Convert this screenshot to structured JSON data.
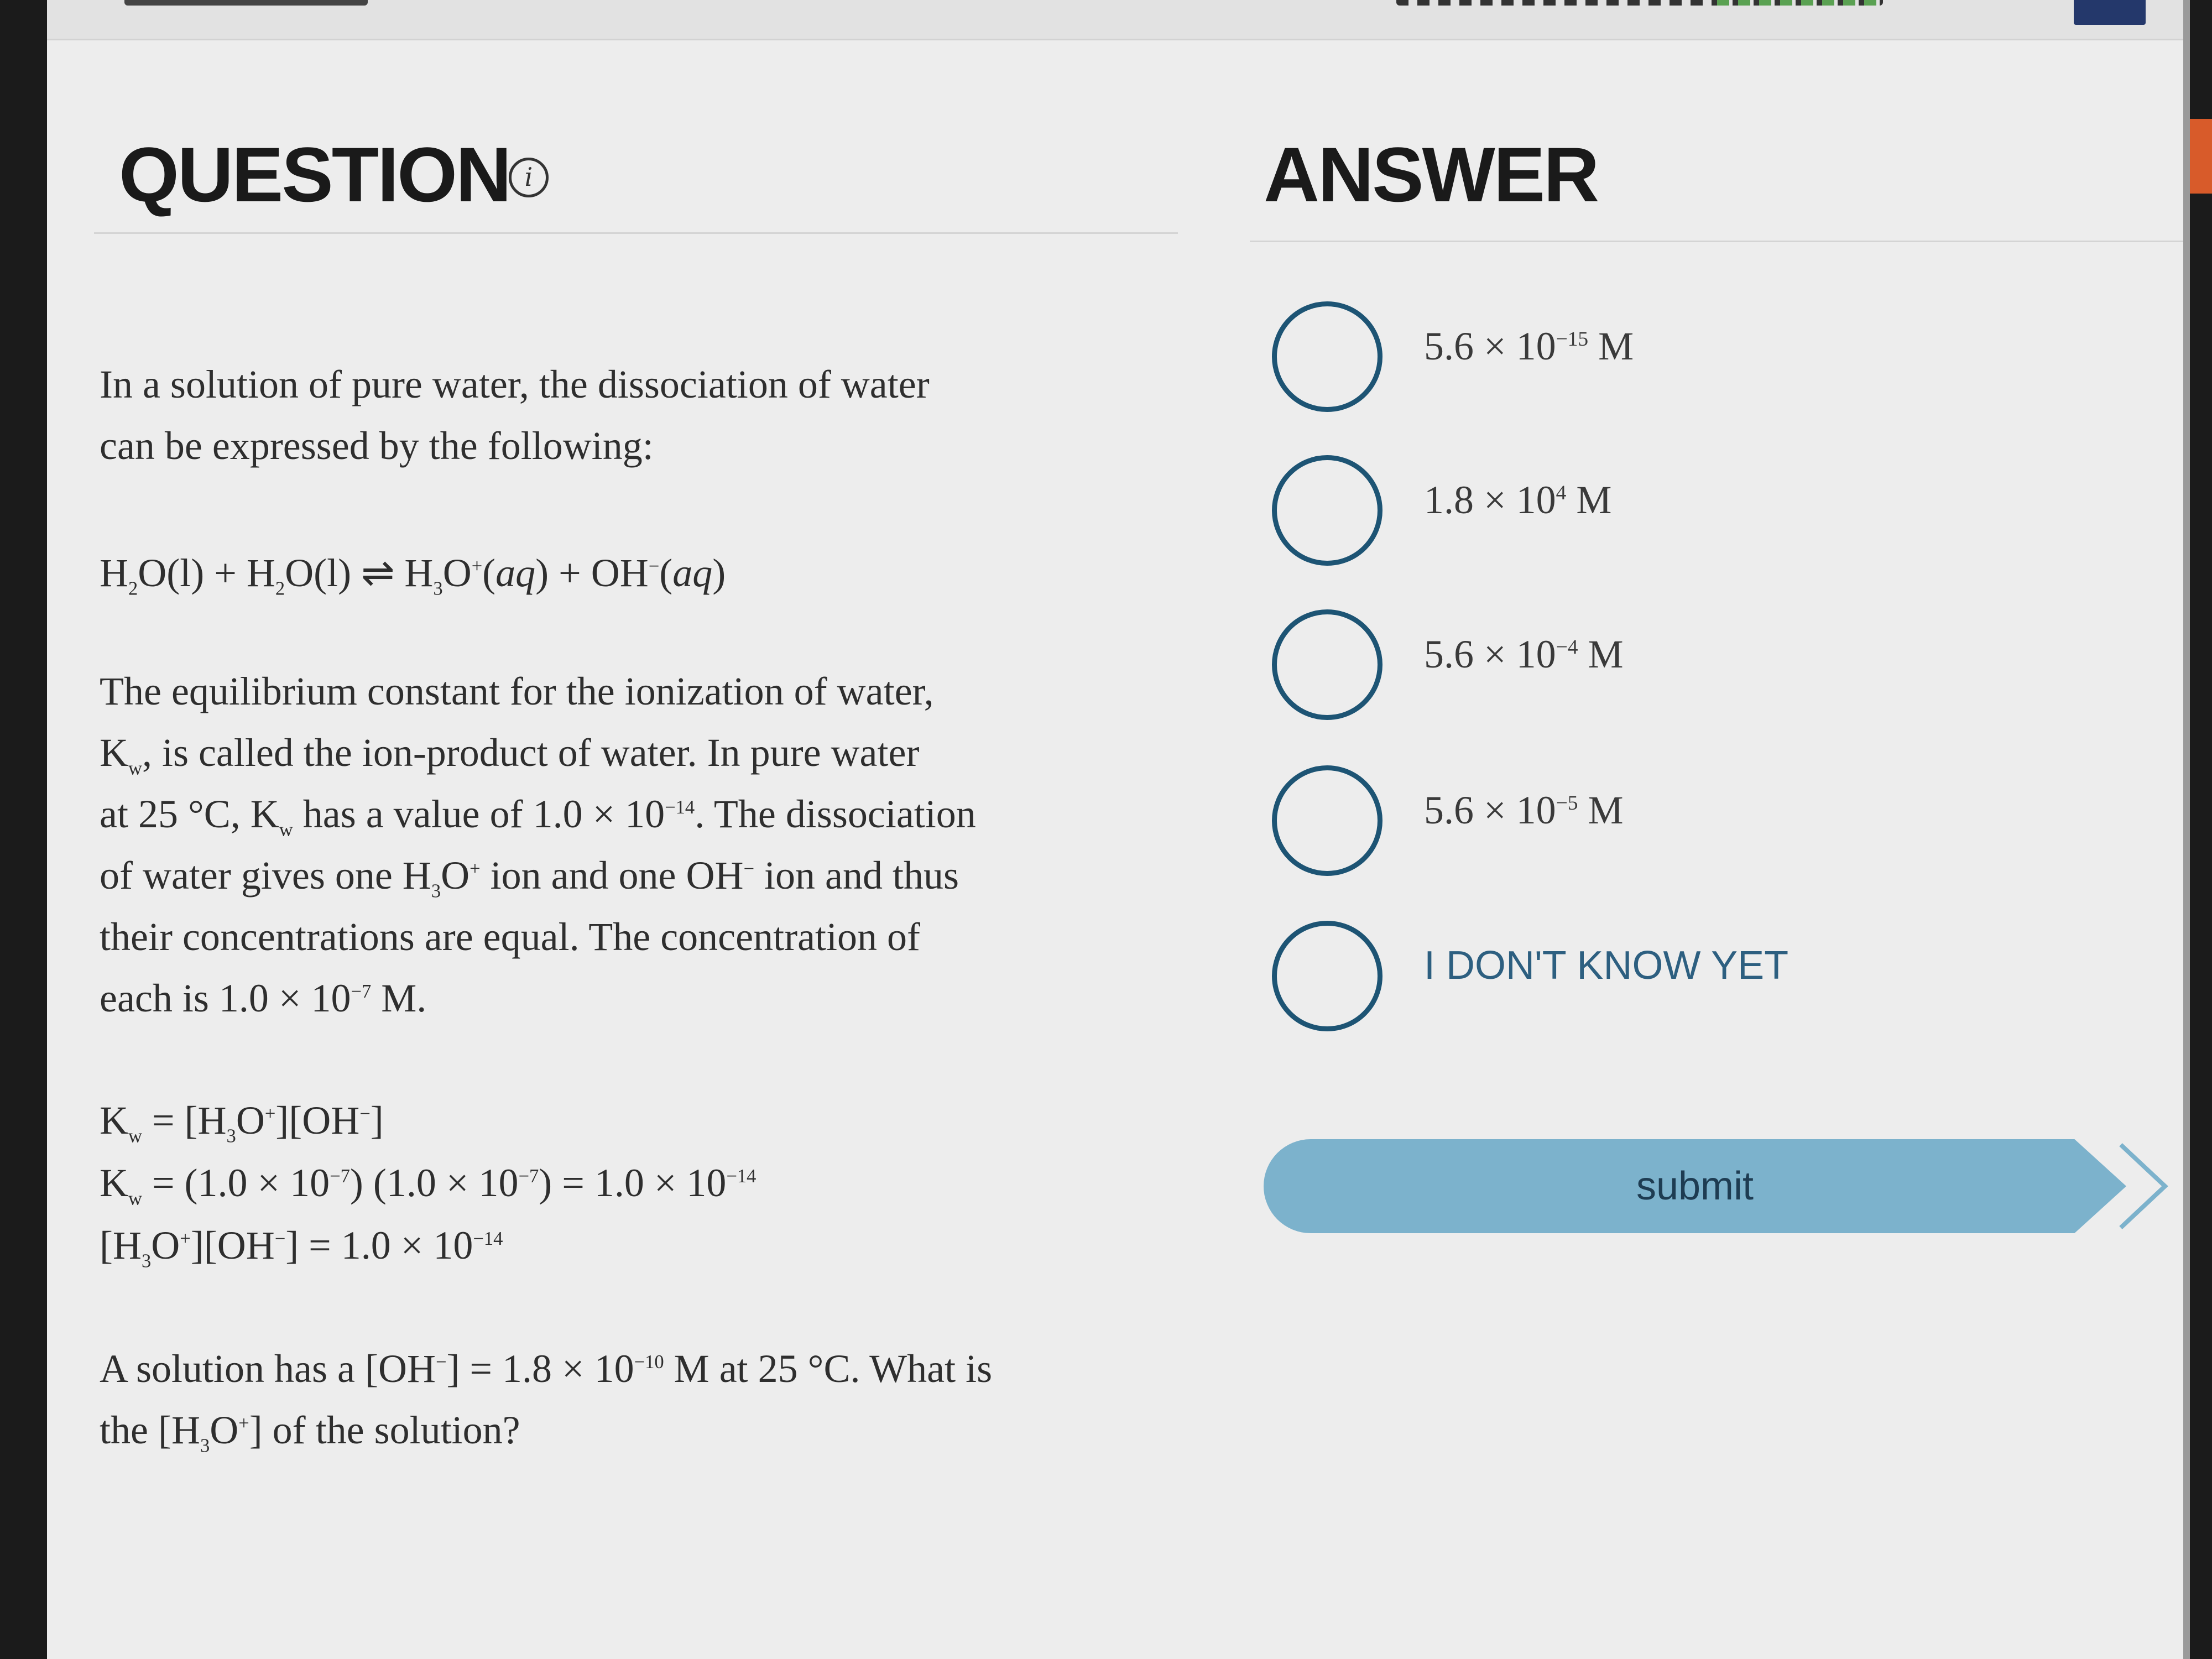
{
  "header": {
    "question_title": "QUESTION",
    "answer_title": "ANSWER",
    "info_glyph": "i"
  },
  "question": {
    "intro_line1": "In a solution of pure water, the dissociation of water",
    "intro_line2": "can be expressed by the following:",
    "equation": "H2O(l) + H2O(l) ⇌ H3O+(aq) + OH−(aq)",
    "para_line1": "The equilibrium constant for the ionization of water,",
    "para_line2": "Kw, is called the ion-product of water. In pure water",
    "para_line3": "at 25 °C, Kw has a value of 1.0 × 10−14. The dissociation",
    "para_line4": "of water gives one H3O+ ion and one OH− ion and thus",
    "para_line5": "their concentrations are equal. The concentration of",
    "para_line6": "each is 1.0 × 10−7 M.",
    "kw_def": "Kw = [H3O+][OH−]",
    "kw_calc": "Kw = (1.0 × 10−7) (1.0 × 10−7) = 1.0 × 10−14",
    "product": "[H3O+][OH−] = 1.0 × 10−14",
    "prompt_line1": "A solution has a [OH−] = 1.8 × 10−10 M at 25 °C. What is",
    "prompt_line2": "the [H3O+] of the solution?"
  },
  "answers": {
    "options": [
      "5.6 × 10−15 M",
      "1.8 × 104 M",
      "5.6 × 10−4 M",
      "5.6 × 10−5 M",
      "I DON'T KNOW YET"
    ],
    "submit_label": "submit"
  },
  "colors": {
    "radio_border": "#1d5474",
    "submit_bg": "#7cb2cc",
    "background": "#ededed"
  }
}
